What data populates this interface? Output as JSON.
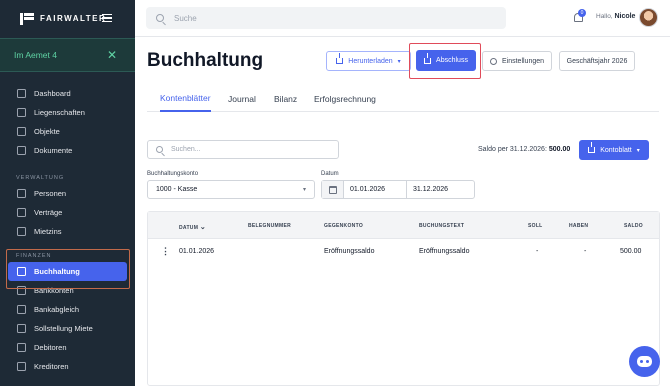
{
  "brand": {
    "name": "FAIRWALTER"
  },
  "property": {
    "name": "Im Aemet 4"
  },
  "sidebar": {
    "items_top": [
      {
        "label": "Dashboard",
        "icon": "dashboard-icon"
      },
      {
        "label": "Liegenschaften",
        "icon": "building-icon"
      },
      {
        "label": "Objekte",
        "icon": "home-icon"
      },
      {
        "label": "Dokumente",
        "icon": "document-icon"
      }
    ],
    "section_verwaltung": "VERWALTUNG",
    "items_verwaltung": [
      {
        "label": "Personen",
        "icon": "person-icon"
      },
      {
        "label": "Verträge",
        "icon": "contract-icon"
      },
      {
        "label": "Mietzins",
        "icon": "rent-icon"
      }
    ],
    "section_finanzen": "FINANZEN",
    "items_finanzen": [
      {
        "label": "Buchhaltung",
        "icon": "ledger-icon",
        "active": true
      },
      {
        "label": "Bankkonten",
        "icon": "bank-icon"
      },
      {
        "label": "Bankabgleich",
        "icon": "reconcile-icon"
      },
      {
        "label": "Sollstellung Miete",
        "icon": "invoice-icon"
      },
      {
        "label": "Debitoren",
        "icon": "debtor-icon"
      },
      {
        "label": "Kreditoren",
        "icon": "creditor-icon"
      }
    ]
  },
  "topbar": {
    "search_placeholder": "Suche",
    "notification_count": "0",
    "greeting": "Hallo,",
    "user_name": "Nicole"
  },
  "main": {
    "title": "Buchhaltung",
    "buttons": {
      "download": "Herunterladen",
      "close": "Abschluss",
      "settings": "Einstellungen",
      "fiscal_year": "Geschäftsjahr 2026"
    },
    "tabs": [
      "Kontenblätter",
      "Journal",
      "Bilanz",
      "Erfolgsrechnung"
    ],
    "search_placeholder": "Suchen...",
    "saldo_label": "Saldo per 31.12.2026:",
    "saldo_value": "500.00",
    "kontoblatt_button": "Kontoblatt",
    "account_label": "Buchhaltungskonto",
    "account_value": "1000 - Kasse",
    "date_label": "Datum",
    "date_from": "01.01.2026",
    "date_to": "31.12.2026",
    "table": {
      "headers": [
        "DATUM",
        "BELEGNUMMER",
        "GEGENKONTO",
        "BUCHUNGSTEXT",
        "SOLL",
        "HABEN",
        "SALDO"
      ],
      "rows": [
        {
          "datum": "01.01.2026",
          "beleg": "",
          "gegenkonto": "Eröffnungssaldo",
          "text": "Eröffnungssaldo",
          "soll": "-",
          "haben": "-",
          "saldo": "500.00"
        }
      ]
    }
  },
  "colors": {
    "accent": "#4663ec",
    "sidebar_bg": "#1e2a36",
    "property_text": "#5fd3a4",
    "highlight_red": "#e04b5a"
  }
}
